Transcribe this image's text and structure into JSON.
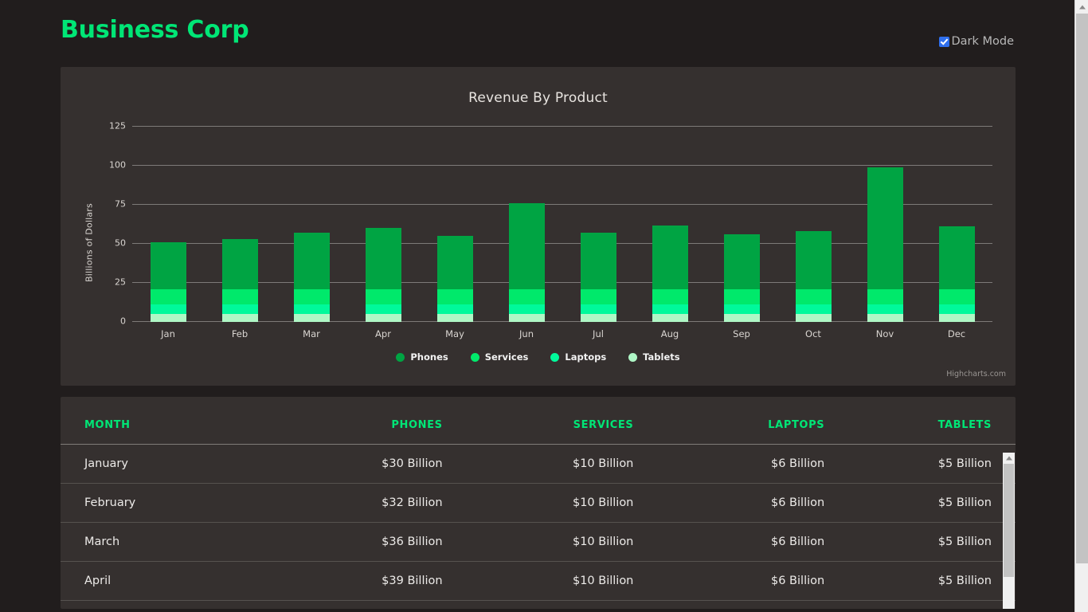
{
  "header": {
    "brand": "Business Corp",
    "dark_mode_label": "Dark Mode",
    "dark_mode_checked": true,
    "accent_color": "#00e676"
  },
  "chart_card": {
    "credit": "Highcharts.com"
  },
  "chart_data": {
    "type": "bar",
    "stacked": true,
    "title": "Revenue By Product",
    "xlabel": "",
    "ylabel": "Billions of Dollars",
    "ylim": [
      0,
      125
    ],
    "yticks": [
      0,
      25,
      50,
      75,
      100,
      125
    ],
    "grid": true,
    "legend_position": "bottom",
    "categories": [
      "Jan",
      "Feb",
      "Mar",
      "Apr",
      "May",
      "Jun",
      "Jul",
      "Aug",
      "Sep",
      "Oct",
      "Nov",
      "Dec"
    ],
    "series": [
      {
        "name": "Phones",
        "color": "#00a443",
        "values": [
          30,
          32,
          36,
          39,
          34,
          55,
          36,
          41,
          35,
          37,
          78,
          40
        ]
      },
      {
        "name": "Services",
        "color": "#00e96b",
        "values": [
          10,
          10,
          10,
          10,
          10,
          10,
          10,
          10,
          10,
          10,
          10,
          10
        ]
      },
      {
        "name": "Laptops",
        "color": "#00f99b",
        "values": [
          6,
          6,
          6,
          6,
          6,
          6,
          6,
          6,
          6,
          6,
          6,
          6
        ]
      },
      {
        "name": "Tablets",
        "color": "#aff7c6",
        "values": [
          5,
          5,
          5,
          5,
          5,
          5,
          5,
          5,
          5,
          5,
          5,
          5
        ]
      }
    ],
    "totals": [
      51,
      53,
      57,
      60,
      55,
      76,
      57,
      62,
      56,
      58,
      99,
      61
    ]
  },
  "table": {
    "columns": [
      "MONTH",
      "PHONES",
      "SERVICES",
      "LAPTOPS",
      "TABLETS"
    ],
    "rows": [
      [
        "January",
        "$30 Billion",
        "$10 Billion",
        "$6 Billion",
        "$5 Billion"
      ],
      [
        "February",
        "$32 Billion",
        "$10 Billion",
        "$6 Billion",
        "$5 Billion"
      ],
      [
        "March",
        "$36 Billion",
        "$10 Billion",
        "$6 Billion",
        "$5 Billion"
      ],
      [
        "April",
        "$39 Billion",
        "$10 Billion",
        "$6 Billion",
        "$5 Billion"
      ]
    ]
  }
}
